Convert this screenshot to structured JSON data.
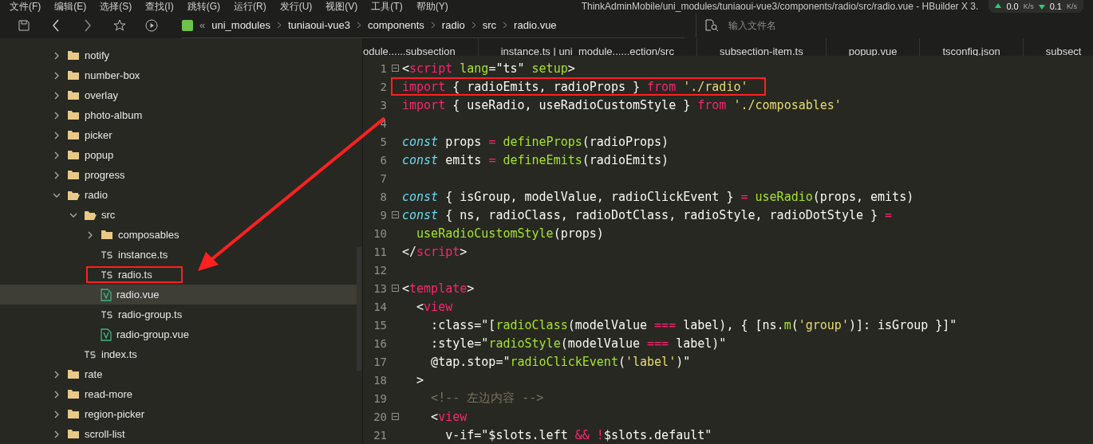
{
  "menu": [
    "文件(F)",
    "编辑(E)",
    "选择(S)",
    "查找(I)",
    "跳转(G)",
    "运行(R)",
    "发行(U)",
    "视图(V)",
    "工具(T)",
    "帮助(Y)"
  ],
  "window": {
    "title": "ThinkAdminMobile/uni_modules/tuniaoui-vue3/components/radio/src/radio.vue - HBuilder X 3."
  },
  "network_speed": {
    "upload": "0.0",
    "upload_unit": "K/s",
    "download": "0.1",
    "download_unit": "K/s"
  },
  "breadcrumb": {
    "overflow": "«",
    "items": [
      "uni_modules",
      "tuniaoui-vue3",
      "components",
      "radio",
      "src",
      "radio.vue"
    ]
  },
  "file_search": {
    "placeholder": "输入文件名"
  },
  "tabs": [
    "odule......subsection",
    "instance.ts | uni_module......ection/src",
    "subsection-item.ts",
    "popup.vue",
    "tsconfig.json",
    "subsect"
  ],
  "tree": [
    {
      "label": "notify",
      "kind": "folder",
      "expanded": false
    },
    {
      "label": "number-box",
      "kind": "folder",
      "expanded": false
    },
    {
      "label": "overlay",
      "kind": "folder",
      "expanded": false
    },
    {
      "label": "photo-album",
      "kind": "folder",
      "expanded": false
    },
    {
      "label": "picker",
      "kind": "folder",
      "expanded": false
    },
    {
      "label": "popup",
      "kind": "folder",
      "expanded": false
    },
    {
      "label": "progress",
      "kind": "folder",
      "expanded": false
    },
    {
      "label": "radio",
      "kind": "folder",
      "expanded": true,
      "children": [
        {
          "label": "src",
          "kind": "folder",
          "expanded": true,
          "children": [
            {
              "label": "composables",
              "kind": "folder",
              "expanded": false
            },
            {
              "label": "instance.ts",
              "kind": "ts",
              "selected": false,
              "annotated": false
            },
            {
              "label": "radio.ts",
              "kind": "ts",
              "selected": false,
              "annotated": true
            },
            {
              "label": "radio.vue",
              "kind": "vue",
              "selected": true,
              "annotated": false
            },
            {
              "label": "radio-group.ts",
              "kind": "ts",
              "selected": false,
              "annotated": false
            },
            {
              "label": "radio-group.vue",
              "kind": "vue",
              "selected": false,
              "annotated": false
            }
          ]
        },
        {
          "label": "index.ts",
          "kind": "ts",
          "selected": false,
          "annotated": false
        }
      ]
    },
    {
      "label": "rate",
      "kind": "folder",
      "expanded": false
    },
    {
      "label": "read-more",
      "kind": "folder",
      "expanded": false
    },
    {
      "label": "region-picker",
      "kind": "folder",
      "expanded": false
    },
    {
      "label": "scroll-list",
      "kind": "folder",
      "expanded": false
    }
  ],
  "code_lines": [
    {
      "number": "1",
      "fold": true,
      "annotated": false,
      "tokens": [
        {
          "kind": "plain",
          "text": "<"
        },
        {
          "kind": "tag",
          "text": "script"
        },
        {
          "kind": "attr",
          "text": " lang"
        },
        {
          "kind": "plain",
          "text": "=\"ts\" "
        },
        {
          "kind": "attr",
          "text": "setup"
        },
        {
          "kind": "plain",
          "text": ">"
        }
      ]
    },
    {
      "number": "2",
      "fold": false,
      "annotated": true,
      "tokens": [
        {
          "kind": "keyword",
          "text": "import"
        },
        {
          "kind": "plain",
          "text": " { radioEmits, radioProps } "
        },
        {
          "kind": "keyword",
          "text": "from"
        },
        {
          "kind": "string",
          "text": " './radio'"
        }
      ]
    },
    {
      "number": "3",
      "fold": false,
      "annotated": false,
      "tokens": [
        {
          "kind": "keyword",
          "text": "import"
        },
        {
          "kind": "plain",
          "text": " { useRadio, useRadioCustomStyle } "
        },
        {
          "kind": "keyword",
          "text": "from"
        },
        {
          "kind": "string",
          "text": " './composables'"
        }
      ]
    },
    {
      "number": "4",
      "fold": false,
      "annotated": false
    },
    {
      "number": "5",
      "fold": false,
      "annotated": false,
      "tokens": [
        {
          "kind": "storage",
          "text": "const"
        },
        {
          "kind": "plain",
          "text": " props "
        },
        {
          "kind": "op",
          "text": "="
        },
        {
          "kind": "func",
          "text": " defineProps"
        },
        {
          "kind": "plain",
          "text": "(radioProps)"
        }
      ]
    },
    {
      "number": "6",
      "fold": false,
      "annotated": false,
      "tokens": [
        {
          "kind": "storage",
          "text": "const"
        },
        {
          "kind": "plain",
          "text": " emits "
        },
        {
          "kind": "op",
          "text": "="
        },
        {
          "kind": "func",
          "text": " defineEmits"
        },
        {
          "kind": "plain",
          "text": "(radioEmits)"
        }
      ]
    },
    {
      "number": "7",
      "fold": false,
      "annotated": false
    },
    {
      "number": "8",
      "fold": false,
      "annotated": false,
      "tokens": [
        {
          "kind": "storage",
          "text": "const"
        },
        {
          "kind": "plain",
          "text": " { isGroup, modelValue, radioClickEvent } "
        },
        {
          "kind": "op",
          "text": "="
        },
        {
          "kind": "func",
          "text": " useRadio"
        },
        {
          "kind": "plain",
          "text": "(props, emits)"
        }
      ]
    },
    {
      "number": "9",
      "fold": true,
      "annotated": false,
      "tokens": [
        {
          "kind": "storage",
          "text": "const"
        },
        {
          "kind": "plain",
          "text": " { ns, radioClass, radioDotClass, radioStyle, radioDotStyle } "
        },
        {
          "kind": "op",
          "text": "="
        }
      ]
    },
    {
      "number": "10",
      "fold": false,
      "annotated": false,
      "tokens": [
        {
          "kind": "func",
          "text": "  useRadioCustomStyle"
        },
        {
          "kind": "plain",
          "text": "(props)"
        }
      ]
    },
    {
      "number": "11",
      "fold": false,
      "annotated": false,
      "tokens": [
        {
          "kind": "plain",
          "text": "</"
        },
        {
          "kind": "tag",
          "text": "script"
        },
        {
          "kind": "plain",
          "text": ">"
        }
      ]
    },
    {
      "number": "12",
      "fold": false,
      "annotated": false
    },
    {
      "number": "13",
      "fold": true,
      "annotated": false,
      "tokens": [
        {
          "kind": "plain",
          "text": "<"
        },
        {
          "kind": "tag",
          "text": "template"
        },
        {
          "kind": "plain",
          "text": ">"
        }
      ]
    },
    {
      "number": "14",
      "fold": false,
      "annotated": false,
      "tokens": [
        {
          "kind": "plain",
          "text": "  <"
        },
        {
          "kind": "tag",
          "text": "view"
        }
      ]
    },
    {
      "number": "15",
      "fold": false,
      "annotated": false,
      "tokens": [
        {
          "kind": "plain",
          "text": "    :class=\"["
        },
        {
          "kind": "func",
          "text": "radioClass"
        },
        {
          "kind": "plain",
          "text": "(modelValue "
        },
        {
          "kind": "op",
          "text": "==="
        },
        {
          "kind": "plain",
          "text": " label), { [ns."
        },
        {
          "kind": "func",
          "text": "m"
        },
        {
          "kind": "plain",
          "text": "("
        },
        {
          "kind": "string",
          "text": "'group'"
        },
        {
          "kind": "plain",
          "text": ")]: isGroup }]\""
        }
      ]
    },
    {
      "number": "16",
      "fold": false,
      "annotated": false,
      "tokens": [
        {
          "kind": "plain",
          "text": "    :style=\""
        },
        {
          "kind": "func",
          "text": "radioStyle"
        },
        {
          "kind": "plain",
          "text": "(modelValue "
        },
        {
          "kind": "op",
          "text": "==="
        },
        {
          "kind": "plain",
          "text": " label)\""
        }
      ]
    },
    {
      "number": "17",
      "fold": false,
      "annotated": false,
      "tokens": [
        {
          "kind": "plain",
          "text": "    @tap.stop=\""
        },
        {
          "kind": "func",
          "text": "radioClickEvent"
        },
        {
          "kind": "plain",
          "text": "("
        },
        {
          "kind": "string",
          "text": "'label'"
        },
        {
          "kind": "plain",
          "text": ")\""
        }
      ]
    },
    {
      "number": "18",
      "fold": false,
      "annotated": false,
      "tokens": [
        {
          "kind": "plain",
          "text": "  >"
        }
      ]
    },
    {
      "number": "19",
      "fold": false,
      "annotated": false,
      "tokens": [
        {
          "kind": "comment",
          "text": "    <!-- 左边内容 -->"
        }
      ]
    },
    {
      "number": "20",
      "fold": true,
      "annotated": false,
      "tokens": [
        {
          "kind": "plain",
          "text": "    <"
        },
        {
          "kind": "tag",
          "text": "view"
        }
      ]
    },
    {
      "number": "21",
      "fold": false,
      "annotated": false,
      "tokens": [
        {
          "kind": "plain",
          "text": "      v-if=\"$slots.left "
        },
        {
          "kind": "op",
          "text": "&&"
        },
        {
          "kind": "op",
          "text": " !"
        },
        {
          "kind": "plain",
          "text": "$slots.default\""
        }
      ]
    }
  ]
}
